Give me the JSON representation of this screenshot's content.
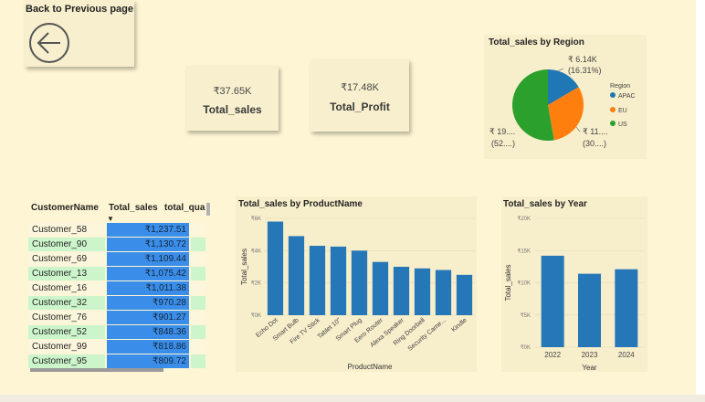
{
  "back_button": {
    "label": "Back to Previous page",
    "icon": "arrow-left-circle-icon"
  },
  "kpis": [
    {
      "value": "₹37.65K",
      "label": "Total_sales"
    },
    {
      "value": "₹17.48K",
      "label": "Total_Profit"
    }
  ],
  "pie": {
    "title": "Total_sales by Region",
    "legend_title": "Region",
    "slices": [
      {
        "name": "APAC",
        "value": 6.14,
        "color": "#1f77b4",
        "label_value": "₹ 6.14K",
        "label_pct": "(16.31%)"
      },
      {
        "name": "EU",
        "value": 11.4,
        "color": "#ff7f0e",
        "label_value": "₹ 11....",
        "label_pct": "(30....)"
      },
      {
        "name": "US",
        "value": 19.6,
        "color": "#2ca02c",
        "label_value": "₹ 19....",
        "label_pct": "(52....)"
      }
    ]
  },
  "table": {
    "headers": [
      "CustomerName",
      "Total_sales",
      "total_qua"
    ],
    "sort_indicator": "▼",
    "rows": [
      {
        "name": "Customer_58",
        "sales": "₹1,237.51"
      },
      {
        "name": "Customer_90",
        "sales": "₹1,130.72"
      },
      {
        "name": "Customer_69",
        "sales": "₹1,109.44"
      },
      {
        "name": "Customer_13",
        "sales": "₹1,075.42"
      },
      {
        "name": "Customer_16",
        "sales": "₹1,011.38"
      },
      {
        "name": "Customer_32",
        "sales": "₹970.28"
      },
      {
        "name": "Customer_76",
        "sales": "₹901.27"
      },
      {
        "name": "Customer_52",
        "sales": "₹848.36"
      },
      {
        "name": "Customer_99",
        "sales": "₹818.86"
      },
      {
        "name": "Customer_95",
        "sales": "₹809.72"
      }
    ]
  },
  "chart_data": [
    {
      "type": "bar",
      "title": "Total_sales by ProductName",
      "xlabel": "ProductName",
      "ylabel": "Total_sales",
      "categories": [
        "Echo Dot",
        "Smart Bulb",
        "Fire TV Stick",
        "Tablet 10\"",
        "Smart Plug",
        "Eero Router",
        "Alexa Speaker",
        "Ring Doorbell",
        "Security Came...",
        "Kindle"
      ],
      "values": [
        5.8,
        4.9,
        4.3,
        4.25,
        4.0,
        3.3,
        3.0,
        2.9,
        2.8,
        2.5
      ],
      "ylim": [
        0,
        6
      ],
      "yticks": [
        0,
        2,
        4,
        6
      ],
      "ytick_labels": [
        "₹0K",
        "₹2K",
        "₹4K",
        "₹6K"
      ],
      "color": "#2677b8"
    },
    {
      "type": "bar",
      "title": "Total_sales by Year",
      "xlabel": "Year",
      "ylabel": "Total_sales",
      "categories": [
        "2022",
        "2023",
        "2024"
      ],
      "values": [
        14.2,
        11.4,
        12.1
      ],
      "ylim": [
        0,
        20
      ],
      "yticks": [
        0,
        5,
        10,
        15,
        20
      ],
      "ytick_labels": [
        "₹0K",
        "₹5K",
        "₹10K",
        "₹15K",
        "₹20K"
      ],
      "color": "#2677b8"
    }
  ]
}
